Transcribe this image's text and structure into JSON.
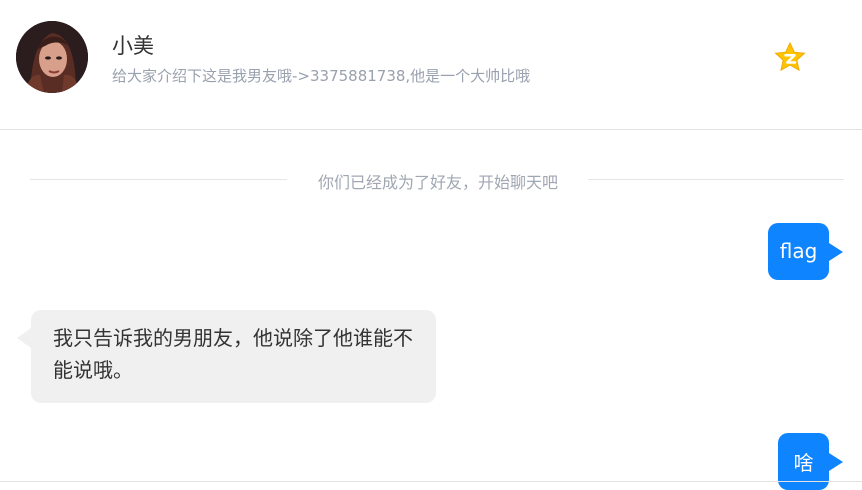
{
  "header": {
    "name": "小美",
    "signature": "给大家介绍下这是我男友哦->3375881738,他是一个大帅比哦",
    "avatar_icon": "user-avatar",
    "qzone_icon": "qzone-star-icon",
    "qzone_color": "#ffc400"
  },
  "chat": {
    "system_notice": "你们已经成为了好友，开始聊天吧",
    "messages": [
      {
        "direction": "outgoing",
        "text": "flag"
      },
      {
        "direction": "incoming",
        "text": "我只告诉我的男朋友，他说除了他谁能不能说哦。"
      },
      {
        "direction": "outgoing",
        "text": "啥"
      }
    ]
  },
  "colors": {
    "outgoing_bubble": "#0f84ff",
    "incoming_bubble": "#f0f0f0",
    "muted_text": "#99a1ae"
  }
}
